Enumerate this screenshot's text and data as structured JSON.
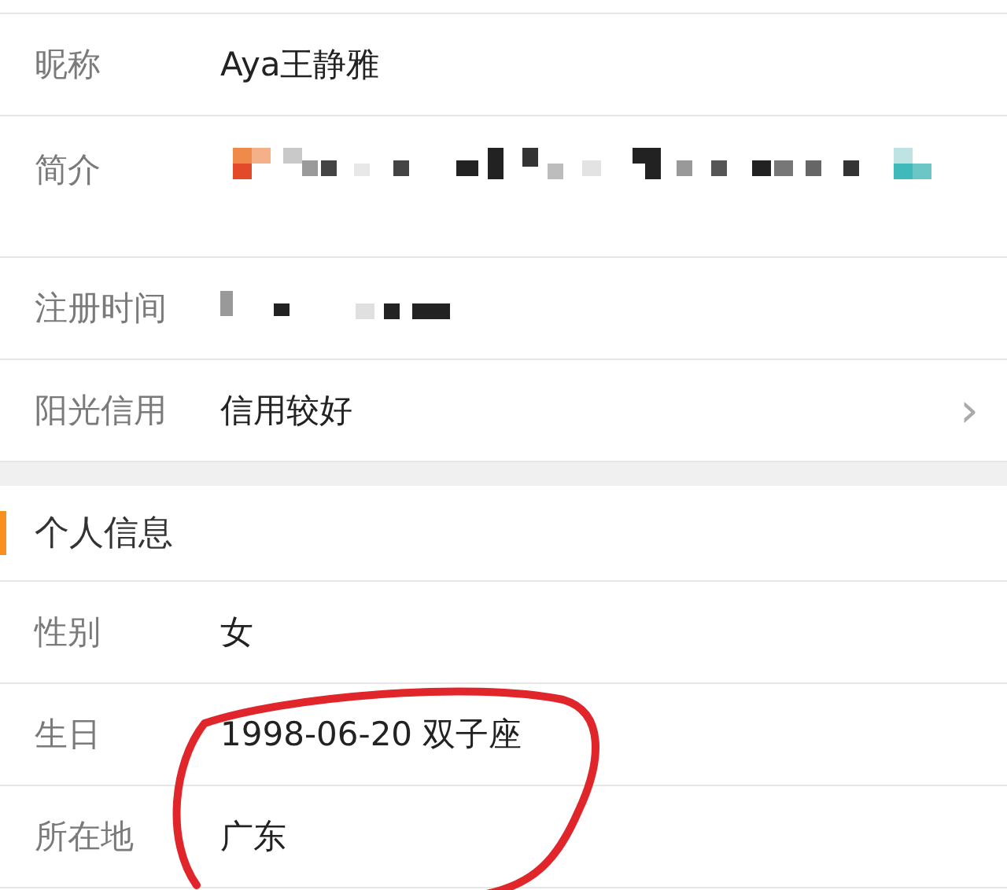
{
  "profile_rows": [
    {
      "kind": "text",
      "label": "昵称",
      "value": "Aya王静雅"
    },
    {
      "kind": "mosaic",
      "label": "简介"
    },
    {
      "kind": "mosaic",
      "label": "注册时间"
    },
    {
      "kind": "link",
      "label": "阳光信用",
      "value": "信用较好",
      "chevron": "›"
    }
  ],
  "section": {
    "title": "个人信息",
    "rows": [
      {
        "label": "性别",
        "value": "女"
      },
      {
        "label": "生日",
        "value": "1998-06-20  双子座"
      },
      {
        "label": "所在地",
        "value": "广东"
      }
    ]
  }
}
